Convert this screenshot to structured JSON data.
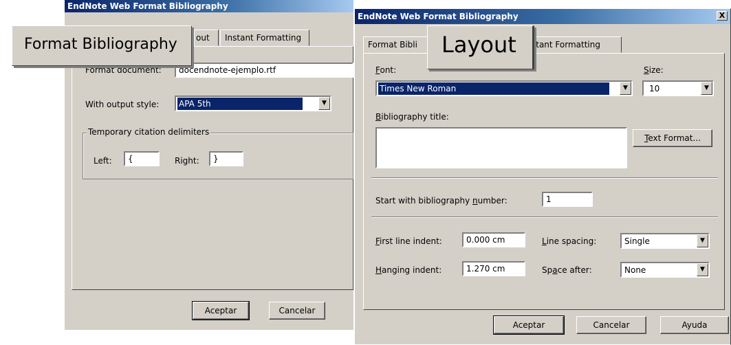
{
  "back_dialog": {
    "title": "EndNote Web Format Bibliography",
    "tab_layout_partial": "out",
    "tab_instant": "Instant Formatting",
    "format_document_label": "Format document:",
    "format_document_value": "docendnote-ejemplo.rtf",
    "output_style_label": "With output style:",
    "output_style_value": "APA 5th",
    "delimiters_group": "Temporary citation delimiters",
    "left_label": "Left:",
    "left_value": "{",
    "right_label": "Right:",
    "right_value": "}",
    "ok": "Aceptar",
    "cancel": "Cancelar"
  },
  "callouts": {
    "format_bibliography": "Format Bibliography",
    "layout": "Layout"
  },
  "front_dialog": {
    "title": "EndNote Web Format Bibliography",
    "close_glyph": "X",
    "tabs": {
      "format_bibliography_partial": "Format Bibli",
      "instant_partial": "stant Formatting"
    },
    "font_label": "Font:",
    "font_value": "Times New Roman",
    "size_label": "Size:",
    "size_value": "10",
    "bib_title_label": "Bibliography title:",
    "bib_title_value": "",
    "text_format_button": "Text Format...",
    "start_number_label": "Start with bibliography number:",
    "start_number_value": "1",
    "first_line_indent_label": "First line indent:",
    "first_line_indent_value": "0.000 cm",
    "line_spacing_label": "Line spacing:",
    "line_spacing_value": "Single",
    "hanging_indent_label": "Hanging indent:",
    "hanging_indent_value": "1.270 cm",
    "space_after_label": "Space after:",
    "space_after_value": "None",
    "ok": "Aceptar",
    "cancel": "Cancelar",
    "help": "Ayuda"
  }
}
